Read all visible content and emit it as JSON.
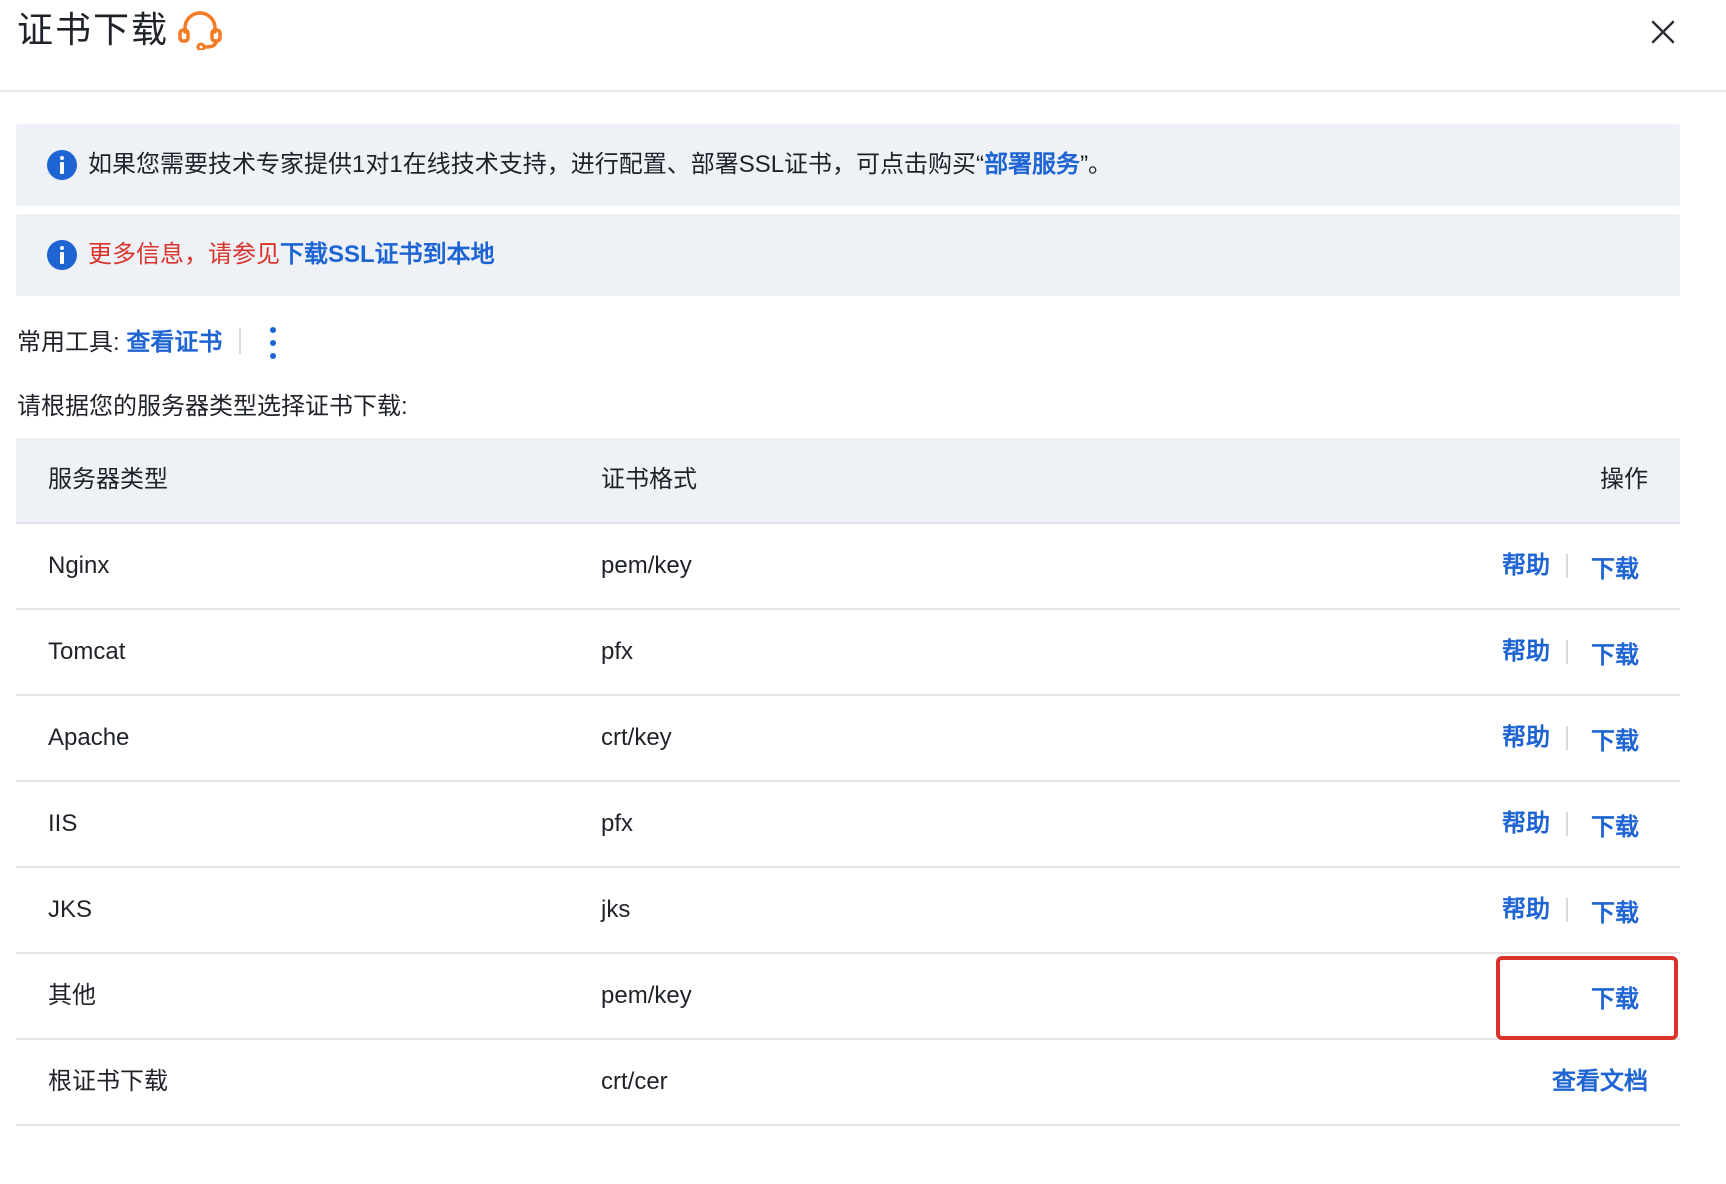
{
  "dialog": {
    "title": "证书下载",
    "support_icon": "headset-icon",
    "close_icon": "close-icon"
  },
  "notices": [
    {
      "icon": "info-icon",
      "text_before": "如果您需要技术专家提供1对1在线技术支持，进行配置、部署SSL证书，可点击购买“",
      "link": "部署服务",
      "text_after": "”。"
    },
    {
      "icon": "info-icon",
      "text_before": "更多信息，请参见",
      "link": "下载SSL证书到本地"
    }
  ],
  "tools": {
    "label": "常用工具:",
    "link": "查看证书",
    "more_icon": "more-vertical-icon"
  },
  "instruction": "请根据您的服务器类型选择证书下载:",
  "table": {
    "headers": [
      "服务器类型",
      "证书格式",
      "操作"
    ],
    "rows": [
      {
        "server": "Nginx",
        "format": "pem/key",
        "help": "帮助",
        "download": "下载"
      },
      {
        "server": "Tomcat",
        "format": "pfx",
        "help": "帮助",
        "download": "下载"
      },
      {
        "server": "Apache",
        "format": "crt/key",
        "help": "帮助",
        "download": "下载"
      },
      {
        "server": "IIS",
        "format": "pfx",
        "help": "帮助",
        "download": "下载"
      },
      {
        "server": "JKS",
        "format": "jks",
        "help": "帮助",
        "download": "下载"
      },
      {
        "server": "其他",
        "format": "pem/key",
        "download": "下载"
      },
      {
        "server": "根证书下载",
        "format": "crt/cer",
        "doc_link": "查看文档"
      }
    ]
  },
  "colors": {
    "link": "#1e64d2",
    "warning_text": "#d9332b",
    "highlight_border": "#d9332b",
    "support_icon": "#f47a25",
    "notice_bg": "#eef2f7"
  }
}
